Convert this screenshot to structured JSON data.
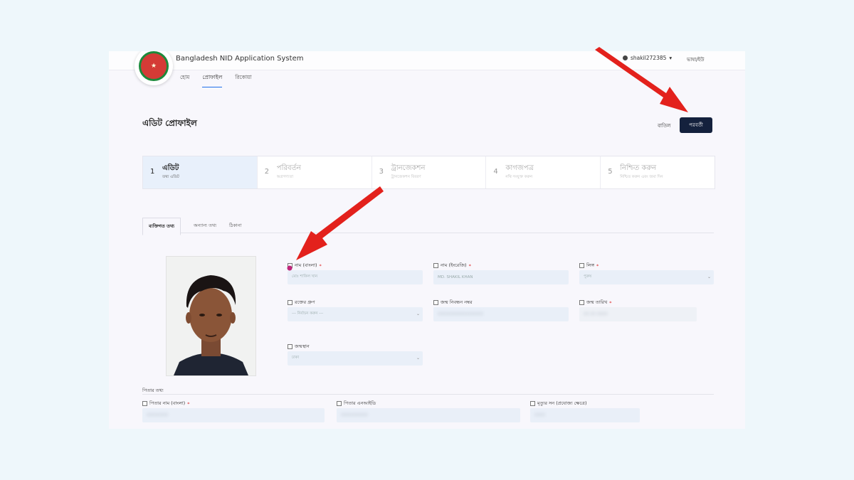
{
  "app": {
    "title": "Bangladesh NID Application System"
  },
  "user": {
    "name": "shakil272385",
    "caret": "▾",
    "language": "ভাষা/ইউ"
  },
  "nav": {
    "items": [
      "হোম",
      "প্রোফাইল",
      "রিকোয়া"
    ]
  },
  "page": {
    "title": "এডিট প্রোফাইল",
    "cancel_label": "বাতিল",
    "next_label": "পরবর্তী"
  },
  "steps": [
    {
      "num": "1",
      "title": "এডিট",
      "sub": "তথ্য এডিট"
    },
    {
      "num": "2",
      "title": "পরিবর্তন",
      "sub": "অগ্রগণ্যতা"
    },
    {
      "num": "3",
      "title": "ট্রানজেকশন",
      "sub": "ট্রানজেকশন বিবরণ"
    },
    {
      "num": "4",
      "title": "কাগজপত্র",
      "sub": "নথি সংযুক্ত করুন"
    },
    {
      "num": "5",
      "title": "নিশ্চিত করুন",
      "sub": "নিশ্চিত করুন এবং জমা দিন"
    }
  ],
  "tabs": [
    "ব্যক্তিগত তথ্য",
    "অন্যান্য তথ্য",
    "ঠিকানা"
  ],
  "fields": {
    "name_bn": {
      "label": "নাম (বাংলা)",
      "required": "*",
      "value": "মোঃ শাকিল খান"
    },
    "name_en": {
      "label": "নাম (ইংরেজি)",
      "required": "*",
      "value": "MD. SHAKIL KHAN"
    },
    "gender": {
      "label": "লিঙ্গ",
      "required": "*",
      "value": "পুরুষ"
    },
    "blood": {
      "label": "রক্তের গ্রুপ",
      "value": "--- নির্বাচন করুন ---"
    },
    "birth_reg": {
      "label": "জন্ম নিবন্ধন নম্বর",
      "value": "XXXXXXXXXXXXXXXXX"
    },
    "dob": {
      "label": "জন্ম তারিখ",
      "required": "*",
      "value": "XX XX XXXX"
    },
    "birth_place": {
      "label": "জন্মস্থান",
      "value": "ঢাকা"
    }
  },
  "parents": {
    "title": "পিতার তথ্য",
    "father_name": {
      "label": "পিতার নাম (বাংলা)",
      "required": "*",
      "value": "XXXXXXXX"
    },
    "father_nid": {
      "label": "পিতার এনআইডি",
      "value": "XXXXXXXXXX"
    },
    "relation": {
      "label": "মৃত্যুর সন (প্রযোজ্য ক্ষেত্রে)",
      "value": "XXXX"
    }
  },
  "colors": {
    "primary": "#14213d",
    "accent": "#1f6feb",
    "arrow": "#e3211c",
    "input_bg": "#e9eff8"
  },
  "icons": {
    "user": "user-icon",
    "chevron": "chevron-down-icon",
    "arrow": "red-pointer-arrow"
  }
}
